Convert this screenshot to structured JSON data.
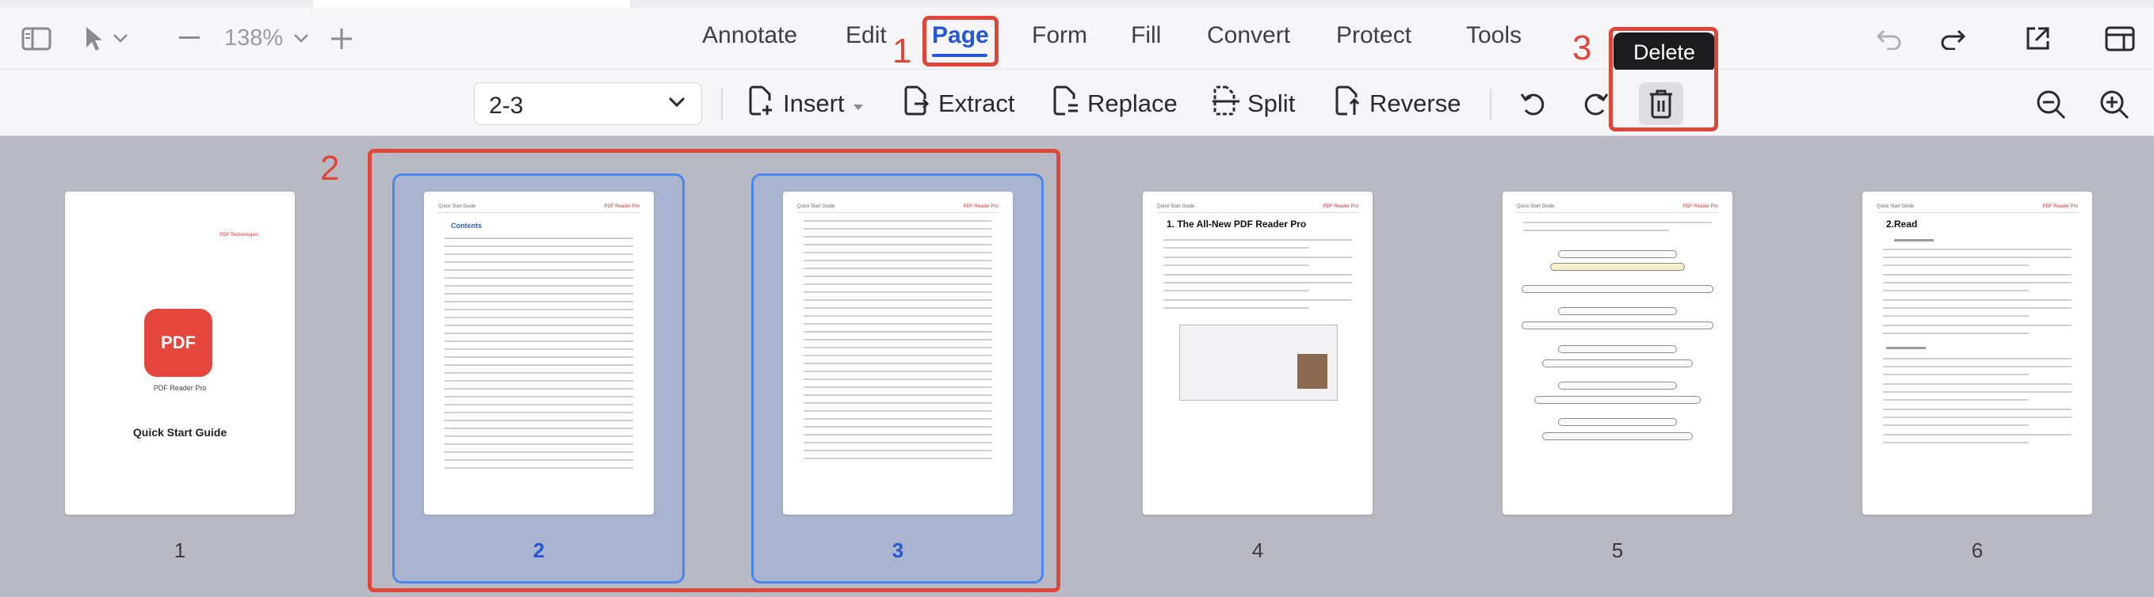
{
  "window": {
    "zoom": "138%"
  },
  "tabs": [
    {
      "label": "Annotate",
      "active": false
    },
    {
      "label": "Edit",
      "active": false
    },
    {
      "label": "Page",
      "active": true
    },
    {
      "label": "Form",
      "active": false
    },
    {
      "label": "Fill",
      "active": false
    },
    {
      "label": "Convert",
      "active": false
    },
    {
      "label": "Protect",
      "active": false
    },
    {
      "label": "Tools",
      "active": false
    }
  ],
  "annotations": [
    "1",
    "2",
    "3"
  ],
  "tooltip": "Delete",
  "toolbar": {
    "page_range": "2-3",
    "insert": "Insert",
    "extract": "Extract",
    "replace": "Replace",
    "split": "Split",
    "reverse": "Reverse"
  },
  "pages": [
    {
      "label": "1",
      "selected": false
    },
    {
      "label": "2",
      "selected": true
    },
    {
      "label": "3",
      "selected": true
    },
    {
      "label": "4",
      "selected": false
    },
    {
      "label": "5",
      "selected": false
    },
    {
      "label": "6",
      "selected": false
    }
  ],
  "thumbnails": {
    "cover_logo": "PDF",
    "cover_app_name": "PDF Reader Pro",
    "cover_title": "Quick Start Guide",
    "cover_brand": "PDF Technologies",
    "header_text": "Quick Start Guide",
    "header_logo": "PDF Reader Pro",
    "contents_heading": "Contents",
    "page4_title": "1. The All-New PDF Reader Pro",
    "page6_title": "2.Read"
  },
  "colors": {
    "accent": "#2456d6",
    "annotation": "#e0453a",
    "selection_border": "#4a86f0",
    "canvas": "#b9b9c3"
  },
  "icons": {
    "sidebar_toggle": "sidebar-icon",
    "pointer_tool": "pointer-icon",
    "zoom_out_minus": "minus-icon",
    "zoom_in_plus": "plus-icon",
    "undo": "undo-icon",
    "redo": "redo-icon",
    "share": "share-icon",
    "layout": "layout-icon",
    "rotate_left": "rotate-left-icon",
    "rotate_right": "rotate-right-icon",
    "delete": "trash-icon",
    "zoom_out": "zoom-out-icon",
    "zoom_in": "zoom-in-icon"
  }
}
